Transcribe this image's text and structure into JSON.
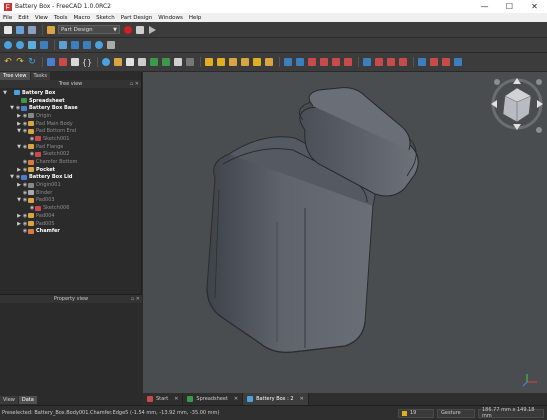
{
  "window": {
    "title": "Battery Box - FreeCAD 1.0.0RC2",
    "minimize": "—",
    "maximize": "☐",
    "close": "✕"
  },
  "menu": [
    "File",
    "Edit",
    "View",
    "Tools",
    "Macro",
    "Sketch",
    "Part Design",
    "Windows",
    "Help"
  ],
  "workbench": {
    "selected": "Part Design"
  },
  "combo": {
    "tabs": [
      "Tree view",
      "Tasks"
    ],
    "tree_title": "Tree view",
    "rows": [
      {
        "label": "Battery Box",
        "indent": 0,
        "arrow": "▼",
        "bold": true,
        "dim": false,
        "eye": false,
        "color": "#4aa3df"
      },
      {
        "label": "Spreadsheet",
        "indent": 1,
        "arrow": "",
        "bold": true,
        "dim": false,
        "eye": false,
        "color": "#3a9a4a"
      },
      {
        "label": "Battery Box Base",
        "indent": 1,
        "arrow": "▼",
        "bold": true,
        "dim": false,
        "eye": true,
        "color": "#4a7fd0"
      },
      {
        "label": "Origin",
        "indent": 2,
        "arrow": "▶",
        "bold": false,
        "dim": true,
        "eye": true,
        "color": "#888888"
      },
      {
        "label": "Pad Main Body",
        "indent": 2,
        "arrow": "▶",
        "bold": false,
        "dim": true,
        "eye": true,
        "color": "#d9a441"
      },
      {
        "label": "Pad Bottom End",
        "indent": 2,
        "arrow": "▼",
        "bold": false,
        "dim": true,
        "eye": true,
        "color": "#d9a441"
      },
      {
        "label": "Sketch001",
        "indent": 3,
        "arrow": "",
        "bold": false,
        "dim": true,
        "eye": true,
        "color": "#c84a4a"
      },
      {
        "label": "Pad Flange",
        "indent": 2,
        "arrow": "▼",
        "bold": false,
        "dim": true,
        "eye": true,
        "color": "#d9a441"
      },
      {
        "label": "Sketch002",
        "indent": 3,
        "arrow": "",
        "bold": false,
        "dim": true,
        "eye": true,
        "color": "#c84a4a"
      },
      {
        "label": "Chamfer Bottom",
        "indent": 2,
        "arrow": "",
        "bold": false,
        "dim": true,
        "eye": true,
        "color": "#d97a41"
      },
      {
        "label": "Pocket",
        "indent": 2,
        "arrow": "▶",
        "bold": true,
        "dim": false,
        "eye": true,
        "color": "#d9a441"
      },
      {
        "label": "Battery Box Lid",
        "indent": 1,
        "arrow": "▼",
        "bold": true,
        "dim": false,
        "eye": true,
        "color": "#4a7fd0"
      },
      {
        "label": "Origin001",
        "indent": 2,
        "arrow": "▶",
        "bold": false,
        "dim": true,
        "eye": true,
        "color": "#888888"
      },
      {
        "label": "Binder",
        "indent": 2,
        "arrow": "",
        "bold": false,
        "dim": true,
        "eye": true,
        "color": "#aaaaaa"
      },
      {
        "label": "Pad003",
        "indent": 2,
        "arrow": "▼",
        "bold": false,
        "dim": true,
        "eye": true,
        "color": "#d9a441"
      },
      {
        "label": "Sketch006",
        "indent": 3,
        "arrow": "",
        "bold": false,
        "dim": true,
        "eye": true,
        "color": "#c84a4a"
      },
      {
        "label": "Pad004",
        "indent": 2,
        "arrow": "▶",
        "bold": false,
        "dim": true,
        "eye": true,
        "color": "#d9a441"
      },
      {
        "label": "Pad005",
        "indent": 2,
        "arrow": "▶",
        "bold": false,
        "dim": true,
        "eye": true,
        "color": "#d9a441"
      },
      {
        "label": "Chamfer",
        "indent": 2,
        "arrow": "",
        "bold": true,
        "dim": false,
        "eye": true,
        "color": "#d97a41"
      }
    ]
  },
  "property": {
    "title": "Property view",
    "tabs": [
      "View",
      "Data"
    ]
  },
  "doc_tabs": [
    {
      "label": "Start",
      "active": false,
      "color": "#c84a4a"
    },
    {
      "label": "Spreadsheet",
      "active": false,
      "color": "#3a9a4a"
    },
    {
      "label": "Battery Box : 2",
      "active": true,
      "color": "#4aa3df"
    }
  ],
  "status": {
    "message": "Preselected: Battery_Box.Body001.Chamfer.Edge5 (-1.54 mm, -13.92 mm, -35.00 mm)",
    "value": "19",
    "nav": "Gesture",
    "dims": "186.77 mm x 149.18 mm"
  },
  "navcube": {
    "face": ""
  },
  "colors": {
    "viewport": "#4a4d50",
    "model": "#5b6068",
    "accent": "#4aa3df"
  }
}
